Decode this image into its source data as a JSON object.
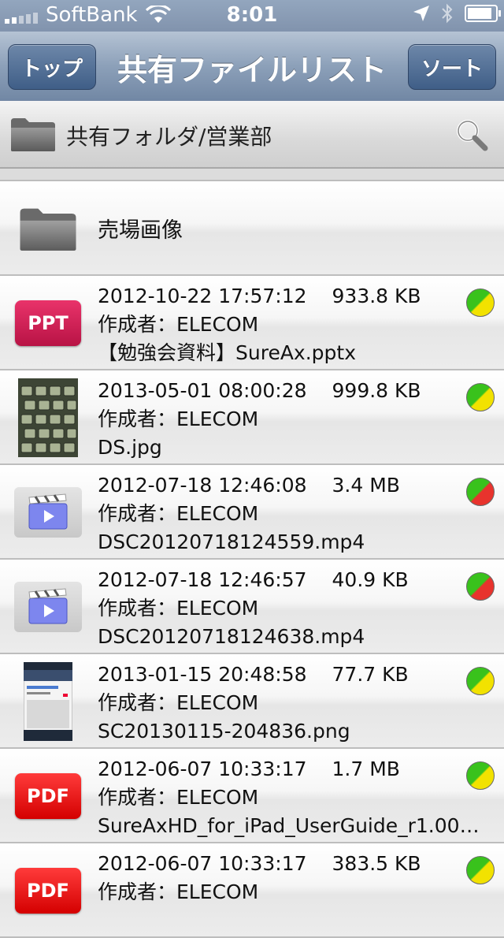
{
  "status_bar": {
    "carrier": "SoftBank",
    "time": "8:01"
  },
  "nav": {
    "left_button": "トップ",
    "title": "共有ファイルリスト",
    "right_button": "ソート"
  },
  "path": {
    "label": "共有フォルダ/営業部"
  },
  "folder_row": {
    "name": "売場画像"
  },
  "files": [
    {
      "datetime": "2012-10-22 17:57:12",
      "size": "933.8 KB",
      "author": "作成者：ELECOM",
      "name": "【勉強会資料】SureAx.pptx",
      "type": "ppt",
      "badge": "PPT",
      "status": "yellow"
    },
    {
      "datetime": "2013-05-01 08:00:28",
      "size": "999.8 KB",
      "author": "作成者：ELECOM",
      "name": "DS.jpg",
      "type": "image-keyboard",
      "status": "yellow"
    },
    {
      "datetime": "2012-07-18 12:46:08",
      "size": "3.4 MB",
      "author": "作成者：ELECOM",
      "name": "DSC20120718124559.mp4",
      "type": "video",
      "status": "red"
    },
    {
      "datetime": "2012-07-18 12:46:57",
      "size": "40.9 KB",
      "author": "作成者：ELECOM",
      "name": "DSC20120718124638.mp4",
      "type": "video",
      "status": "red"
    },
    {
      "datetime": "2013-01-15 20:48:58",
      "size": "77.7 KB",
      "author": "作成者：ELECOM",
      "name": "SC20130115-204836.png",
      "type": "image-screenshot",
      "status": "yellow"
    },
    {
      "datetime": "2012-06-07 10:33:17",
      "size": "1.7 MB",
      "author": "作成者：ELECOM",
      "name": "SureAxHD_for_iPad_UserGuide_r1.00…",
      "type": "pdf",
      "badge": "PDF",
      "status": "yellow"
    },
    {
      "datetime": "2012-06-07 10:33:17",
      "size": "383.5 KB",
      "author": "作成者：ELECOM",
      "name": "",
      "type": "pdf",
      "badge": "PDF",
      "status": "yellow"
    }
  ],
  "colors": {
    "status_yellow": "#f2e200",
    "status_red": "#e8332d",
    "status_green": "#39c21c"
  }
}
